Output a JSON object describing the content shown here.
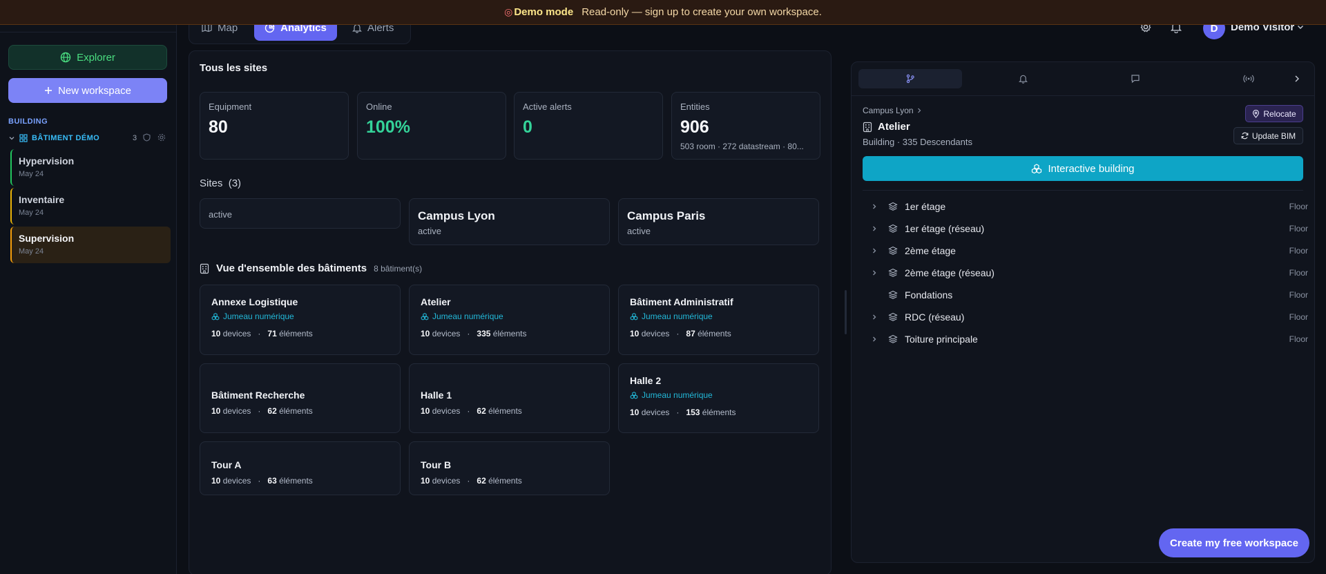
{
  "banner": {
    "title": "Demo mode",
    "subtitle": "Read-only — sign up to create your own workspace."
  },
  "sidebar": {
    "explorer_label": "Explorer",
    "new_workspace_label": "New workspace",
    "section_label": "BUILDING",
    "workspace": {
      "name": "BÂTIMENT DÉMO",
      "count": "3"
    },
    "views": [
      {
        "title": "Hypervision",
        "date": "May 24",
        "color": "#22c55e"
      },
      {
        "title": "Inventaire",
        "date": "May 24",
        "color": "#eab308"
      },
      {
        "title": "Supervision",
        "date": "May 24",
        "color": "#f59e0b"
      }
    ]
  },
  "nav": {
    "tabs": [
      {
        "label": "Map",
        "icon": "map-icon"
      },
      {
        "label": "Analytics",
        "icon": "analytics-icon",
        "active": true
      },
      {
        "label": "Alerts",
        "icon": "bell-icon"
      }
    ]
  },
  "user": {
    "initial": "D",
    "name": "Demo Visitor"
  },
  "main": {
    "title": "Tous les sites",
    "stats": [
      {
        "label": "Equipment",
        "value": "80"
      },
      {
        "label": "Online",
        "value": "100%"
      },
      {
        "label": "Active alerts",
        "value": "0"
      },
      {
        "label": "Entities",
        "value": "906",
        "sub": "503 room · 272 datastream · 80..."
      }
    ],
    "sites_label": "Sites",
    "sites_count": "(3)",
    "sites": [
      {
        "name": "",
        "status": "active"
      },
      {
        "name": "Campus Lyon",
        "status": "active"
      },
      {
        "name": "Campus Paris",
        "status": "active"
      }
    ],
    "buildings_title": "Vue d'ensemble des bâtiments",
    "buildings_count": "8 bâtiment(s)",
    "twin_label": "Jumeau numérique",
    "devices_word": "devices",
    "elements_word": "éléments",
    "buildings": [
      {
        "name": "Annexe Logistique",
        "twin": true,
        "devices": "10",
        "elements": "71"
      },
      {
        "name": "Atelier",
        "twin": true,
        "devices": "10",
        "elements": "335"
      },
      {
        "name": "Bâtiment Administratif",
        "twin": true,
        "devices": "10",
        "elements": "87"
      },
      {
        "name": "Bâtiment Recherche",
        "twin": false,
        "devices": "10",
        "elements": "62"
      },
      {
        "name": "Halle 1",
        "twin": false,
        "devices": "10",
        "elements": "62"
      },
      {
        "name": "Halle 2",
        "twin": true,
        "devices": "10",
        "elements": "153"
      },
      {
        "name": "Tour A",
        "twin": false,
        "devices": "10",
        "elements": "63"
      },
      {
        "name": "Tour B",
        "twin": false,
        "devices": "10",
        "elements": "62"
      }
    ]
  },
  "detail": {
    "breadcrumb": "Campus Lyon",
    "title": "Atelier",
    "subtitle": "Building · 335 Descendants",
    "relocate_label": "Relocate",
    "update_bim_label": "Update BIM",
    "interactive_label": "Interactive building",
    "tree": [
      {
        "name": "1er étage",
        "type": "Floor",
        "expandable": true
      },
      {
        "name": "1er étage (réseau)",
        "type": "Floor",
        "expandable": true
      },
      {
        "name": "2ème étage",
        "type": "Floor",
        "expandable": true
      },
      {
        "name": "2ème étage (réseau)",
        "type": "Floor",
        "expandable": true
      },
      {
        "name": "Fondations",
        "type": "Floor",
        "expandable": false
      },
      {
        "name": "RDC (réseau)",
        "type": "Floor",
        "expandable": true
      },
      {
        "name": "Toiture principale",
        "type": "Floor",
        "expandable": true
      }
    ]
  },
  "cta_label": "Create my free workspace"
}
